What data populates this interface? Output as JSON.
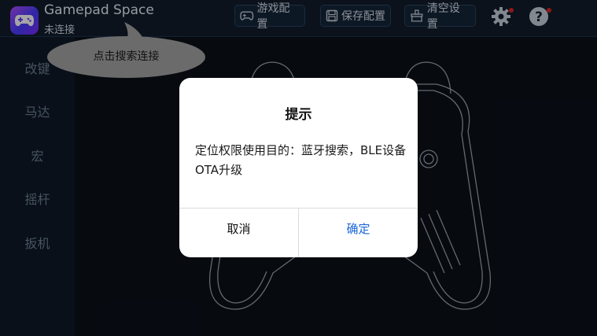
{
  "header": {
    "title": "Gamepad Space",
    "status": "未连接",
    "game_config_label": "游戏配置",
    "save_config_label": "保存配置",
    "clear_settings_label": "清空设置",
    "icons": [
      "gamepad-app-icon",
      "gamepad-icon",
      "save-icon",
      "clear-icon",
      "gear-icon",
      "help-icon"
    ]
  },
  "sidebar": {
    "items": [
      {
        "label": "改键"
      },
      {
        "label": "马达"
      },
      {
        "label": "宏"
      },
      {
        "label": "摇杆"
      },
      {
        "label": "扳机"
      }
    ]
  },
  "tooltip": {
    "text": "点击搜索连接"
  },
  "dialog": {
    "title": "提示",
    "message": "定位权限使用目的：蓝牙搜索，BLE设备OTA升级",
    "cancel_label": "取消",
    "confirm_label": "确定"
  },
  "colors": {
    "accent": "#1a66d6",
    "badge": "#e02424",
    "background": "#0d1521"
  }
}
